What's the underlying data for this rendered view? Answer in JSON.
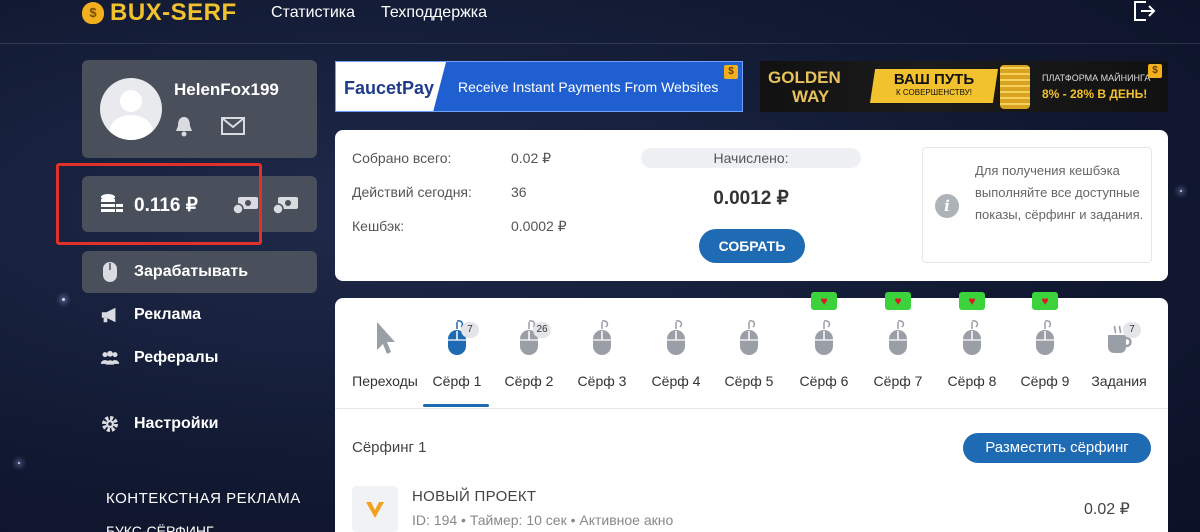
{
  "header": {
    "logo": "BUX-SERF",
    "nav": [
      "Статистика",
      "Техподдержка"
    ]
  },
  "sidebar": {
    "username": "HelenFox199",
    "balance": "0.116 ₽",
    "menu": [
      {
        "label": "Зарабатывать",
        "icon": "mouse-icon"
      },
      {
        "label": "Реклама",
        "icon": "megaphone-icon"
      },
      {
        "label": "Рефералы",
        "icon": "users-icon"
      },
      {
        "label": "Настройки",
        "icon": "gear-icon"
      }
    ],
    "section_title": "КОНТЕКСТНАЯ РЕКЛАМА",
    "section_sub": "БУКС-СЁРФИНГ"
  },
  "banners": {
    "faucet": {
      "brand": "FaucetPay",
      "tagline": "Receive Instant Payments From Websites"
    },
    "golden": {
      "title1": "GOLDEN",
      "title2": "WAY",
      "mid1": "ВАШ ПУТЬ",
      "mid2": "К СОВЕРШЕНСТВУ!",
      "right1": "ПЛАТФОРМА МАЙНИНГА",
      "right2": "8% - 28% В ДЕНЬ!"
    }
  },
  "stats": {
    "collected_label": "Собрано всего:",
    "collected_value": "0.02 ₽",
    "actions_label": "Действий сегодня:",
    "actions_value": "36",
    "cashback_label": "Кешбэк:",
    "cashback_value": "0.0002 ₽",
    "accrued_label": "Начислено:",
    "accrued_value": "0.0012 ₽",
    "collect_button": "СОБРАТЬ",
    "info_text": "Для получения кешбэка выполняйте все доступные показы, сёрфинг и задания."
  },
  "tabs": [
    {
      "label": "Переходы",
      "icon": "cursor-icon",
      "count": null,
      "heart": false,
      "active": false
    },
    {
      "label": "Сёрф 1",
      "icon": "mouse-icon",
      "count": "7",
      "heart": false,
      "active": true
    },
    {
      "label": "Сёрф 2",
      "icon": "mouse-icon",
      "count": "26",
      "heart": false,
      "active": false
    },
    {
      "label": "Сёрф 3",
      "icon": "mouse-icon",
      "count": null,
      "heart": false,
      "active": false
    },
    {
      "label": "Сёрф 4",
      "icon": "mouse-icon",
      "count": null,
      "heart": false,
      "active": false
    },
    {
      "label": "Сёрф 5",
      "icon": "mouse-icon",
      "count": null,
      "heart": false,
      "active": false
    },
    {
      "label": "Сёрф 6",
      "icon": "mouse-icon",
      "count": null,
      "heart": true,
      "active": false
    },
    {
      "label": "Сёрф 7",
      "icon": "mouse-icon",
      "count": null,
      "heart": true,
      "active": false
    },
    {
      "label": "Сёрф 8",
      "icon": "mouse-icon",
      "count": null,
      "heart": true,
      "active": false
    },
    {
      "label": "Сёрф 9",
      "icon": "mouse-icon",
      "count": null,
      "heart": true,
      "active": false
    },
    {
      "label": "Задания",
      "icon": "coffee-cup-icon",
      "count": "7",
      "heart": false,
      "active": false
    }
  ],
  "surf": {
    "title": "Сёрфинг 1",
    "place_button": "Разместить сёрфинг",
    "task": {
      "title": "НОВЫЙ ПРОЕКТ",
      "meta": "ID: 194 • Таймер: 10 сек • Активное акно",
      "price": "0.02 ₽"
    }
  },
  "colors": {
    "accent": "#1e6bb3",
    "highlight": "#e0322b",
    "logo": "#f2c12e"
  }
}
